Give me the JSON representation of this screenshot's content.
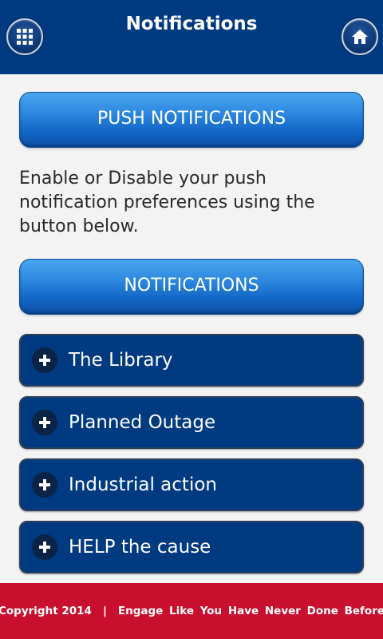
{
  "header": {
    "title": "Notifications",
    "menu_icon": "grid-menu-icon",
    "home_icon": "home-icon"
  },
  "push_button": {
    "label": "PUSH NOTIFICATIONS"
  },
  "description": "Enable or Disable your push notification preferences using the button below.",
  "notifications_button": {
    "label": "NOTIFICATIONS"
  },
  "accordion": [
    {
      "label": "The Library",
      "icon": "plus-icon"
    },
    {
      "label": "Planned Outage",
      "icon": "plus-icon"
    },
    {
      "label": "Industrial action",
      "icon": "plus-icon"
    },
    {
      "label": "HELP the cause",
      "icon": "plus-icon"
    }
  ],
  "footer": {
    "copyright": "Copyright 2014",
    "separator": "|",
    "tagline": "Engage Like You Have Never Done Before"
  },
  "colors": {
    "header_bg": "#003a80",
    "button_gradient_top": "#4aa6f0",
    "button_gradient_bottom": "#0b4fa5",
    "accordion_bg": "#003a80",
    "footer_bg": "#c8102e",
    "page_bg": "#f3f3f3"
  }
}
